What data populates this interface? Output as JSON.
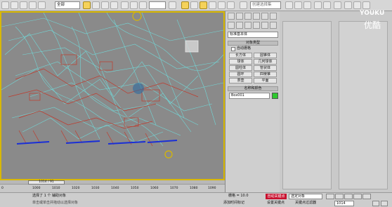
{
  "toolbar": {
    "filter_value": "全部",
    "selection_set_placeholder": "创建选择集"
  },
  "command_panel": {
    "dropdown_value": "标准基本体",
    "rollout_object_type": "对象类型",
    "autogrid_label": "自动栅格",
    "object_buttons": [
      "长方体",
      "圆锥体",
      "球体",
      "几何球体",
      "圆柱体",
      "管状体",
      "圆环",
      "四棱锥",
      "茶壶",
      "平面"
    ],
    "rollout_name_color": "名称和颜色",
    "name_value": "Box001",
    "swatch_color": "#2ec82e"
  },
  "timeline": {
    "frame_label": "1014 / 91",
    "ticks": [
      "0",
      "1000",
      "1010",
      "1020",
      "1030",
      "1040",
      "1050",
      "1060",
      "1070",
      "1080",
      "1090"
    ]
  },
  "status": {
    "selected_text": "选择了 1 个  辅助对象",
    "prompt_text": "单击或单击并拖动以选择对象",
    "grid_label": "栅格 = 10.0",
    "add_time_tag": "添加时间标记",
    "autokey_label": "自动关键点",
    "setkey_label": "设置关键点",
    "key_filter_value": "选定对象",
    "key_filters_label": "关键点过滤器",
    "frame_value": "1014"
  },
  "watermark": {
    "text": "YOUKU",
    "sub": "优酷"
  },
  "colors": {
    "viewport_border": "#d9b800",
    "autokey_bg": "#c8102e",
    "wire_cyan": "#6fe0e0",
    "wire_red": "#c0392b",
    "bone_blue": "#1a2fd6"
  }
}
